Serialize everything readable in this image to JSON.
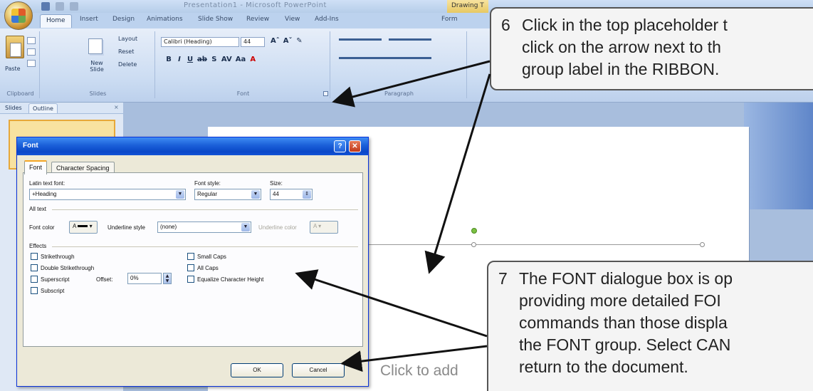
{
  "window": {
    "app_title": "Presentation1 - Microsoft PowerPoint",
    "contextual_tab": "Drawing T"
  },
  "ribbon": {
    "tabs": [
      "Home",
      "Insert",
      "Design",
      "Animations",
      "Slide Show",
      "Review",
      "View",
      "Add-Ins",
      "Form"
    ],
    "clipboard": {
      "paste": "Paste",
      "label": "Clipboard"
    },
    "slides": {
      "new_slide": "New Slide",
      "layout": "Layout",
      "reset": "Reset",
      "delete": "Delete",
      "label": "Slides"
    },
    "font": {
      "font_name": "Calibri (Heading)",
      "font_size": "44",
      "label": "Font"
    },
    "paragraph": {
      "label": "Paragraph"
    }
  },
  "pane": {
    "tabs": [
      "Slides",
      "Outline"
    ]
  },
  "slide": {
    "placeholder_text": "Click to add"
  },
  "dialog": {
    "title": "Font",
    "tabs": [
      "Font",
      "Character Spacing"
    ],
    "latin_font_label": "Latin text font:",
    "latin_font_value": "+Heading",
    "font_style_label": "Font style:",
    "font_style_value": "Regular",
    "size_label": "Size:",
    "size_value": "44",
    "all_text_label": "All text",
    "font_color_label": "Font color",
    "underline_style_label": "Underline style",
    "underline_style_value": "(none)",
    "underline_color_label": "Underline color",
    "effects_label": "Effects",
    "effects_left": [
      "Strikethrough",
      "Double Strikethrough",
      "Superscript",
      "Subscript"
    ],
    "offset_label": "Offset:",
    "offset_value": "0%",
    "effects_right": [
      "Small Caps",
      "All Caps",
      "Equalize Character Height"
    ],
    "ok": "OK",
    "cancel": "Cancel"
  },
  "callouts": [
    {
      "number": "6",
      "lines": [
        "Click in the top placeholder t",
        "click on the arrow next to th",
        "group label in the RIBBON."
      ]
    },
    {
      "number": "7",
      "lines": [
        "The FONT dialogue box is op",
        "providing more detailed FOI",
        "commands than those displa",
        "the FONT group.  Select CAN",
        "return to the document."
      ]
    }
  ]
}
